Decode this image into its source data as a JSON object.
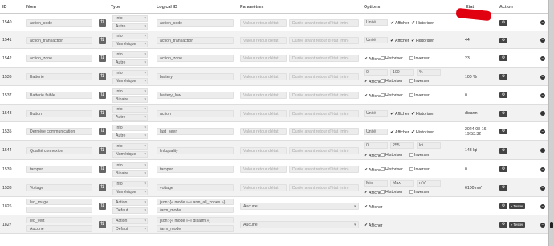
{
  "headers": {
    "id": "ID",
    "nom": "Nom",
    "type": "Type",
    "logical": "Logical ID",
    "params": "Paramètres",
    "options": "Options",
    "etat": "Etat",
    "action": "Action"
  },
  "labels": {
    "ph_val": "Valeur retour d'état",
    "ph_dur": "Durée avant retour d'état (min)",
    "unit": "Unité",
    "min": "Min",
    "max": "Max",
    "afficher": "Afficher",
    "historiser": "Historiser",
    "inverser": "Inverser",
    "tester": "Tester",
    "info": "Info",
    "action": "Action",
    "autre": "Autre",
    "numerique": "Numérique",
    "binaire": "Binaire",
    "defaut": "Défaut",
    "aucune": "Aucune",
    "action_ph": "Aucune"
  },
  "rows": [
    {
      "id": "1540",
      "nom": "action_code",
      "type": "Info",
      "sub": "Autre",
      "lid": "action_code",
      "etat": ""
    },
    {
      "id": "1541",
      "nom": "action_transaction",
      "type": "Info",
      "sub": "Numérique",
      "lid": "action_transaction",
      "etat": "44"
    },
    {
      "id": "1542",
      "nom": "action_zone",
      "type": "Info",
      "sub": "Autre",
      "lid": "action_zone",
      "etat": "23"
    },
    {
      "id": "1536",
      "nom": "Batterie",
      "type": "Info",
      "sub": "Numérique",
      "lid": "battery",
      "min": "0",
      "max": "100",
      "unit": "%",
      "etat": "100 %"
    },
    {
      "id": "1537",
      "nom": "Batterie faible",
      "type": "Info",
      "sub": "Binaire",
      "lid": "battery_low",
      "etat": "0"
    },
    {
      "id": "1543",
      "nom": "Button",
      "type": "Info",
      "sub": "Autre",
      "lid": "action",
      "etat": "disarm"
    },
    {
      "id": "1535",
      "nom": "Dernière communication",
      "type": "Info",
      "sub": "Autre",
      "lid": "last_seen",
      "etat": "2024-08-16 19:53:32"
    },
    {
      "id": "1544",
      "nom": "Qualité connexion",
      "type": "Info",
      "sub": "Numérique",
      "lid": "linkquality",
      "min": "0",
      "max": "255",
      "unit": "lqi",
      "etat": "148 lqi"
    },
    {
      "id": "1539",
      "nom": "tamper",
      "type": "Info",
      "sub": "Binaire",
      "lid": "tamper",
      "etat": "0"
    },
    {
      "id": "1538",
      "nom": "Voltage",
      "type": "Info",
      "sub": "Numérique",
      "lid": "voltage",
      "min": "Min",
      "max": "Max",
      "unit": "mV",
      "etat": "6100 mV"
    },
    {
      "id": "1826",
      "nom": "led_rouge",
      "type": "Action",
      "sub": "Défaut",
      "lid": "json::{« mode »:« arm_all_zones »}",
      "lid2": "/arm_mode"
    },
    {
      "id": "1827",
      "nom": "led_vert",
      "type": "Action",
      "sub": "Défaut",
      "lid": "json::{« mode »:« disarm »}",
      "lid2": "/arm_mode",
      "nomsel": "Aucune"
    }
  ]
}
